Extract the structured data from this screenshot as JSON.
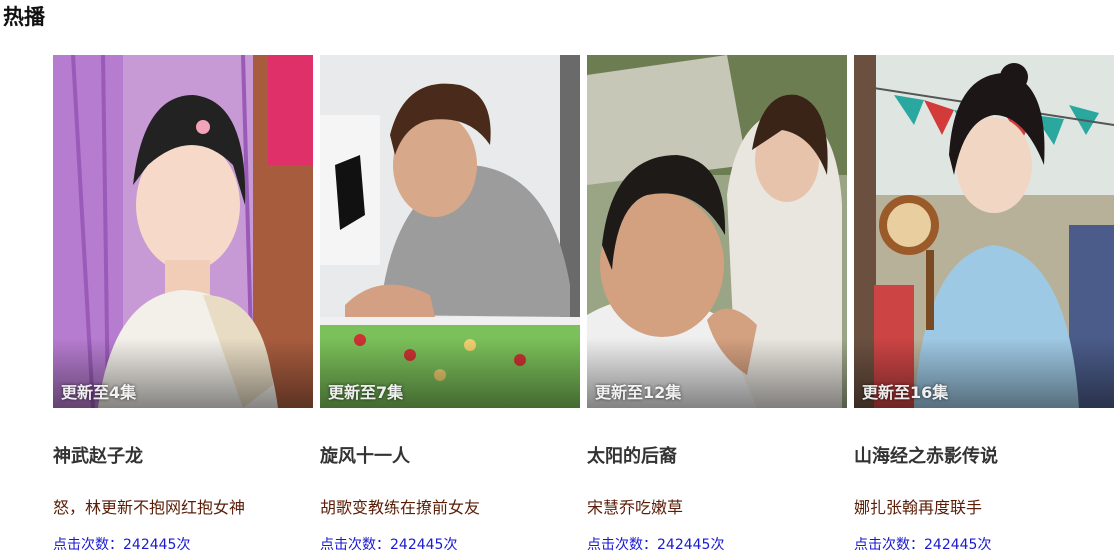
{
  "section": {
    "title": "热播"
  },
  "cards": [
    {
      "episode": "更新至4集",
      "title": "神武赵子龙",
      "desc": "怒，林更新不抱网红抱女神",
      "clicks": "点击次数：242445次"
    },
    {
      "episode": "更新至7集",
      "title": "旋风十一人",
      "desc": "胡歌变教练在撩前女友",
      "clicks": "点击次数：242445次"
    },
    {
      "episode": "更新至12集",
      "title": "太阳的后裔",
      "desc": "宋慧乔吃嫩草",
      "clicks": "点击次数：242445次"
    },
    {
      "episode": "更新至16集",
      "title": "山海经之赤影传说",
      "desc": "娜扎张翰再度联手",
      "clicks": "点击次数：242445次"
    }
  ]
}
